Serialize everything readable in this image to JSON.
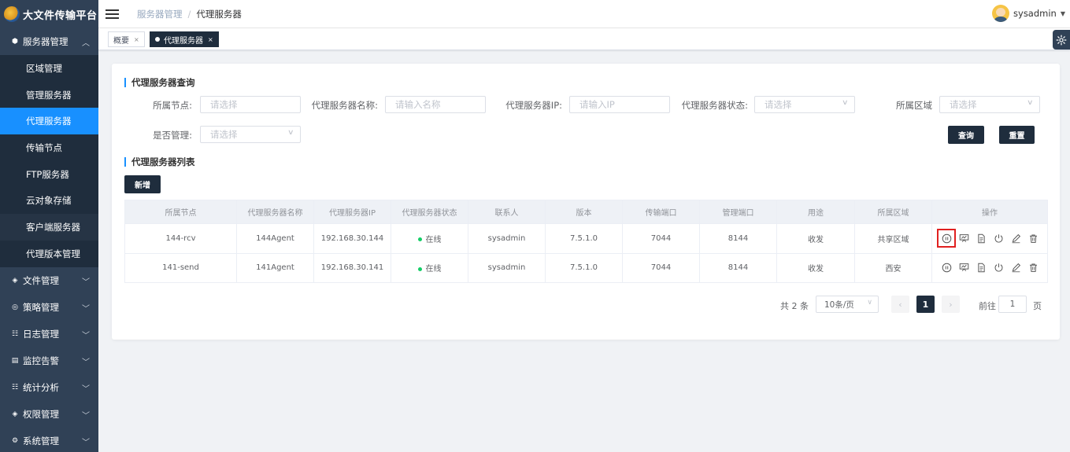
{
  "app": {
    "title": "大文件传输平台"
  },
  "sidebar": {
    "groups": [
      {
        "label": "服务器管理",
        "icon": "cube-icon",
        "expanded": true,
        "items": [
          {
            "label": "区域管理"
          },
          {
            "label": "管理服务器"
          },
          {
            "label": "代理服务器",
            "active": true
          },
          {
            "label": "传输节点"
          },
          {
            "label": "FTP服务器"
          },
          {
            "label": "云对象存储"
          },
          {
            "label": "客户端服务器",
            "hover": true
          },
          {
            "label": "代理版本管理"
          }
        ]
      },
      {
        "label": "文件管理",
        "icon": "layers-icon"
      },
      {
        "label": "策略管理",
        "icon": "strategy-icon"
      },
      {
        "label": "日志管理",
        "icon": "log-icon"
      },
      {
        "label": "监控告警",
        "icon": "monitor-icon"
      },
      {
        "label": "统计分析",
        "icon": "stats-icon"
      },
      {
        "label": "权限管理",
        "icon": "layers-icon"
      },
      {
        "label": "系统管理",
        "icon": "settings-icon"
      }
    ]
  },
  "header": {
    "breadcrumb": [
      "服务器管理",
      "代理服务器"
    ],
    "user": "sysadmin"
  },
  "tags": {
    "overview": "概要",
    "current": "代理服务器"
  },
  "query": {
    "title": "代理服务器查询",
    "fields": {
      "node": {
        "label": "所属节点:",
        "placeholder": "请选择"
      },
      "name": {
        "label": "代理服务器名称:",
        "placeholder": "请输入名称"
      },
      "ip": {
        "label": "代理服务器IP:",
        "placeholder": "请输入IP"
      },
      "status": {
        "label": "代理服务器状态:",
        "placeholder": "请选择"
      },
      "region": {
        "label": "所属区域",
        "placeholder": "请选择"
      },
      "managed": {
        "label": "是否管理:",
        "placeholder": "请选择"
      }
    },
    "search_label": "查询",
    "reset_label": "重置"
  },
  "list": {
    "title": "代理服务器列表",
    "add_label": "新增",
    "columns": [
      "所属节点",
      "代理服务器名称",
      "代理服务器IP",
      "代理服务器状态",
      "联系人",
      "版本",
      "传输端口",
      "管理端口",
      "用途",
      "所属区域",
      "操作"
    ],
    "rows": [
      {
        "node": "144-rcv",
        "name": "144Agent",
        "ip": "192.168.30.144",
        "status": "在线",
        "contact": "sysadmin",
        "version": "7.5.1.0",
        "transfer_port": "7044",
        "manage_port": "8144",
        "usage": "收发",
        "region": "共享区域"
      },
      {
        "node": "141-send",
        "name": "141Agent",
        "ip": "192.168.30.141",
        "status": "在线",
        "contact": "sysadmin",
        "version": "7.5.1.0",
        "transfer_port": "7044",
        "manage_port": "8144",
        "usage": "收发",
        "region": "西安"
      }
    ],
    "operations": [
      "pause-icon",
      "monitor-chart-icon",
      "document-icon",
      "power-icon",
      "edit-icon",
      "delete-icon"
    ]
  },
  "pagination": {
    "total": "共 2 条",
    "page_size": "10条/页",
    "current_page": "1",
    "goto_prefix": "前往",
    "goto_value": "1",
    "goto_suffix": "页"
  },
  "colors": {
    "sidebar": "#304156",
    "submenu": "#1f2d3d",
    "active": "#1890ff",
    "online": "#13ce66",
    "highlight": "#e02020"
  }
}
